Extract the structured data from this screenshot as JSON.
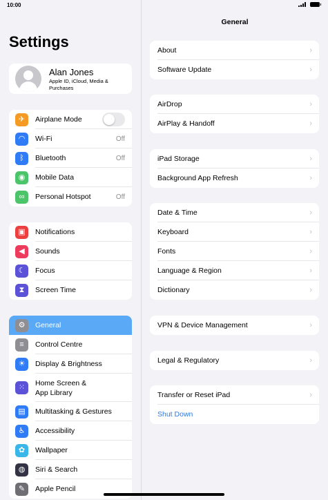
{
  "status": {
    "time": "10:00"
  },
  "sidebar": {
    "title": "Settings",
    "profile": {
      "name": "Alan Jones",
      "subtitle": "Apple ID, iCloud, Media & Purchases"
    },
    "group1": [
      {
        "label": "Airplane Mode",
        "icon": "airplane-icon",
        "glyph": "✈",
        "color": "#f59a23",
        "toggle": true,
        "toggle_on": false
      },
      {
        "label": "Wi-Fi",
        "icon": "wifi-icon",
        "glyph": "◠",
        "color": "#2f7cf6",
        "value": "Off"
      },
      {
        "label": "Bluetooth",
        "icon": "bluetooth-icon",
        "glyph": "ᛒ",
        "color": "#2f7cf6",
        "value": "Off"
      },
      {
        "label": "Mobile Data",
        "icon": "antenna-icon",
        "glyph": "◉",
        "color": "#4cc46a",
        "value": ""
      },
      {
        "label": "Personal Hotspot",
        "icon": "link-icon",
        "glyph": "∞",
        "color": "#4cc46a",
        "value": "Off"
      }
    ],
    "group2": [
      {
        "label": "Notifications",
        "icon": "bell-icon",
        "glyph": "▣",
        "color": "#ec4040"
      },
      {
        "label": "Sounds",
        "icon": "speaker-icon",
        "glyph": "◀",
        "color": "#ec3b5c"
      },
      {
        "label": "Focus",
        "icon": "moon-icon",
        "glyph": "☾",
        "color": "#5b52d8"
      },
      {
        "label": "Screen Time",
        "icon": "hourglass-icon",
        "glyph": "⧗",
        "color": "#5b52d8"
      }
    ],
    "group3": [
      {
        "label": "General",
        "icon": "gear-icon",
        "glyph": "⚙",
        "color": "#8e8e93",
        "selected": true
      },
      {
        "label": "Control Centre",
        "icon": "switches-icon",
        "glyph": "≡",
        "color": "#8e8e93"
      },
      {
        "label": "Display & Brightness",
        "icon": "sun-icon",
        "glyph": "☀",
        "color": "#2f7cf6"
      },
      {
        "label": "Home Screen &",
        "label2": "App Library",
        "icon": "grid-icon",
        "glyph": "⁙",
        "color": "#5b52d8",
        "tall": true
      },
      {
        "label": "Multitasking & Gestures",
        "icon": "multitask-icon",
        "glyph": "▤",
        "color": "#2f7cf6"
      },
      {
        "label": "Accessibility",
        "icon": "accessibility-icon",
        "glyph": "♿",
        "color": "#2f7cf6"
      },
      {
        "label": "Wallpaper",
        "icon": "flower-icon",
        "glyph": "✿",
        "color": "#39b7e8"
      },
      {
        "label": "Siri & Search",
        "icon": "siri-icon",
        "glyph": "◍",
        "color": "#333344"
      },
      {
        "label": "Apple Pencil",
        "icon": "pencil-icon",
        "glyph": "✎",
        "color": "#6e6e73"
      }
    ]
  },
  "main": {
    "title": "General",
    "groups": [
      [
        "About",
        "Software Update"
      ],
      [
        "AirDrop",
        "AirPlay & Handoff"
      ],
      [
        "iPad Storage",
        "Background App Refresh"
      ],
      [
        "Date & Time",
        "Keyboard",
        "Fonts",
        "Language & Region",
        "Dictionary"
      ],
      [
        "VPN & Device Management"
      ],
      [
        "Legal & Regulatory"
      ],
      [
        "Transfer or Reset iPad",
        "Shut Down"
      ]
    ],
    "link_items": [
      "Shut Down"
    ]
  }
}
